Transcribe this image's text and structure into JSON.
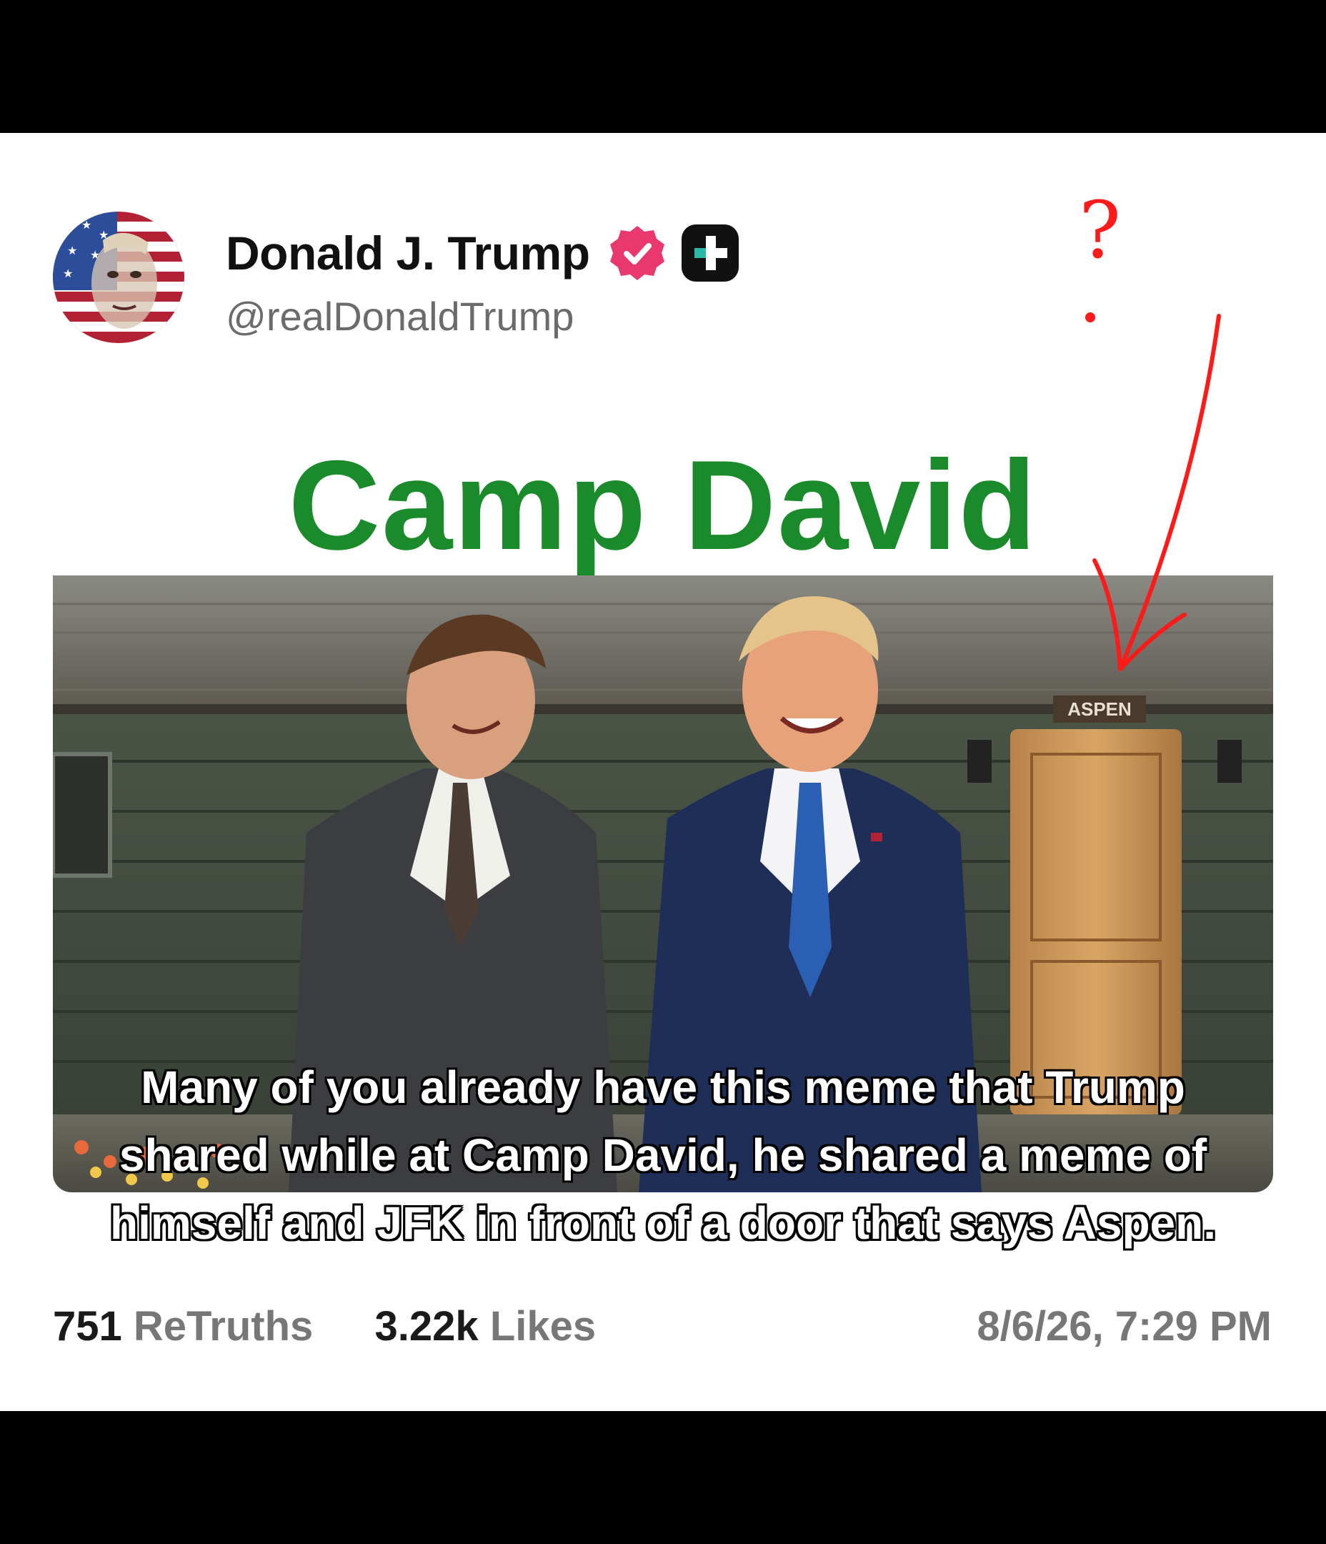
{
  "post": {
    "author_name": "Donald J. Trump",
    "handle": "@realDonaldTrump",
    "verified_icon": "verified-badge-icon",
    "plus_icon": "truth-plus-icon",
    "image_title": "Camp David",
    "door_sign": "ASPEN",
    "retruths_count": "751",
    "retruths_label": "ReTruths",
    "likes_count": "3.22k",
    "likes_label": "Likes",
    "timestamp": "8/6/26, 7:29 PM"
  },
  "caption": {
    "line1": "Many of you already have this meme that Trump",
    "line2": "shared while at Camp David, he shared a meme of",
    "line3": "himself and JFK in front of a door that says Aspen."
  },
  "annotation": {
    "mark": "?",
    "color": "#ff1a1a"
  },
  "colors": {
    "title_green": "#1b8a2a",
    "badge_pink": "#e8386e"
  }
}
